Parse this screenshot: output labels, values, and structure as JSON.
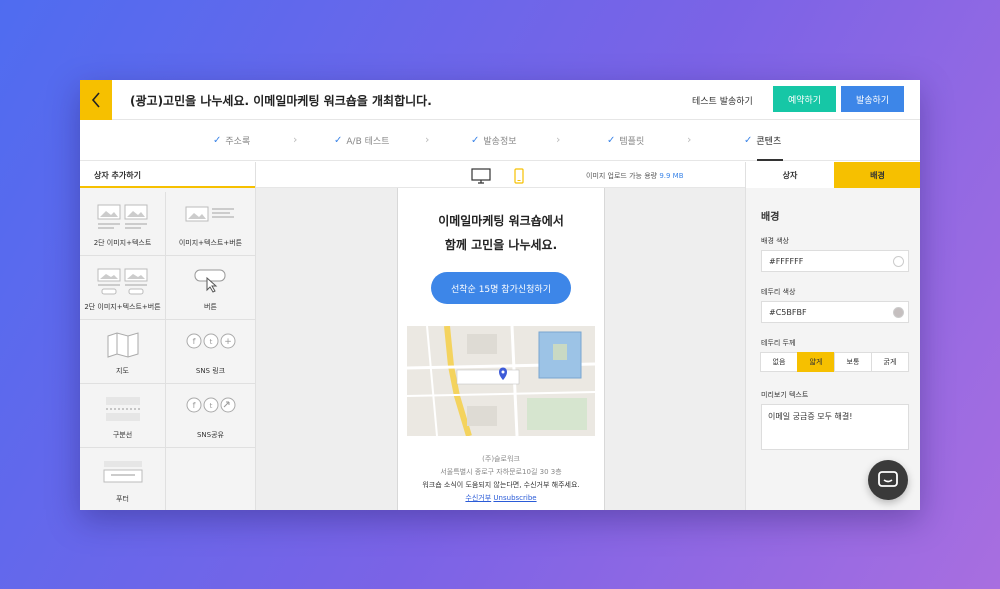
{
  "header": {
    "title": "(광고)고민을 나누세요. 이메일마케팅 워크숍을 개최합니다.",
    "test_send": "테스트 발송하기",
    "reserve": "예약하기",
    "send": "발송하기"
  },
  "steps": [
    {
      "label": "주소록",
      "done": true
    },
    {
      "label": "A/B 테스트",
      "done": true
    },
    {
      "label": "발송정보",
      "done": true
    },
    {
      "label": "템플릿",
      "done": true
    },
    {
      "label": "콘텐츠",
      "done": true,
      "active": true
    }
  ],
  "left_panel": {
    "title": "상자 추가하기",
    "blocks": [
      {
        "label": "2단 이미지+텍스트",
        "icon": "two-image-text-icon"
      },
      {
        "label": "이미지+텍스트+버튼",
        "icon": "image-text-button-icon"
      },
      {
        "label": "2단 이미지+텍스트+버튼",
        "icon": "two-image-text-button-icon"
      },
      {
        "label": "버튼",
        "icon": "button-block-icon"
      },
      {
        "label": "지도",
        "icon": "map-icon"
      },
      {
        "label": "SNS 링크",
        "icon": "sns-link-icon"
      },
      {
        "label": "구분선",
        "icon": "divider-icon"
      },
      {
        "label": "SNS공유",
        "icon": "sns-share-icon"
      },
      {
        "label": "푸터",
        "icon": "footer-icon"
      }
    ]
  },
  "center": {
    "upload_label": "이미지 업로드 가능 용량",
    "upload_value": "9.9 MB",
    "email": {
      "heading_line1": "이메일마케팅 워크숍에서",
      "heading_line2": "함께 고민을 나누세요.",
      "cta": "선착순 15명 참가신청하기",
      "company": "(주)슬로워크",
      "address": "서울특별시 종로구 자하문로10길 30 3층",
      "notice": "워크숍 소식이 도움되지 않는다면, 수신거부 해주세요.",
      "unsub_ko": "수신거부",
      "unsub_en": "Unsubscribe"
    }
  },
  "right_panel": {
    "tab_box": "상자",
    "tab_bg": "배경",
    "section_title": "배경",
    "bg_color_label": "배경 색상",
    "bg_color_value": "#FFFFFF",
    "border_color_label": "테두리 색상",
    "border_color_value": "#C5BFBF",
    "border_thickness_label": "테두리 두께",
    "thickness_options": [
      "없음",
      "얇게",
      "보통",
      "굵게"
    ],
    "thickness_selected": "얇게",
    "preview_label": "미리보기 텍스트",
    "preview_value": "이메일 궁금증 모두 해결!"
  },
  "colors": {
    "accent_yellow": "#F6C000",
    "reserve_green": "#16C7A6",
    "send_blue": "#3D86E8"
  }
}
